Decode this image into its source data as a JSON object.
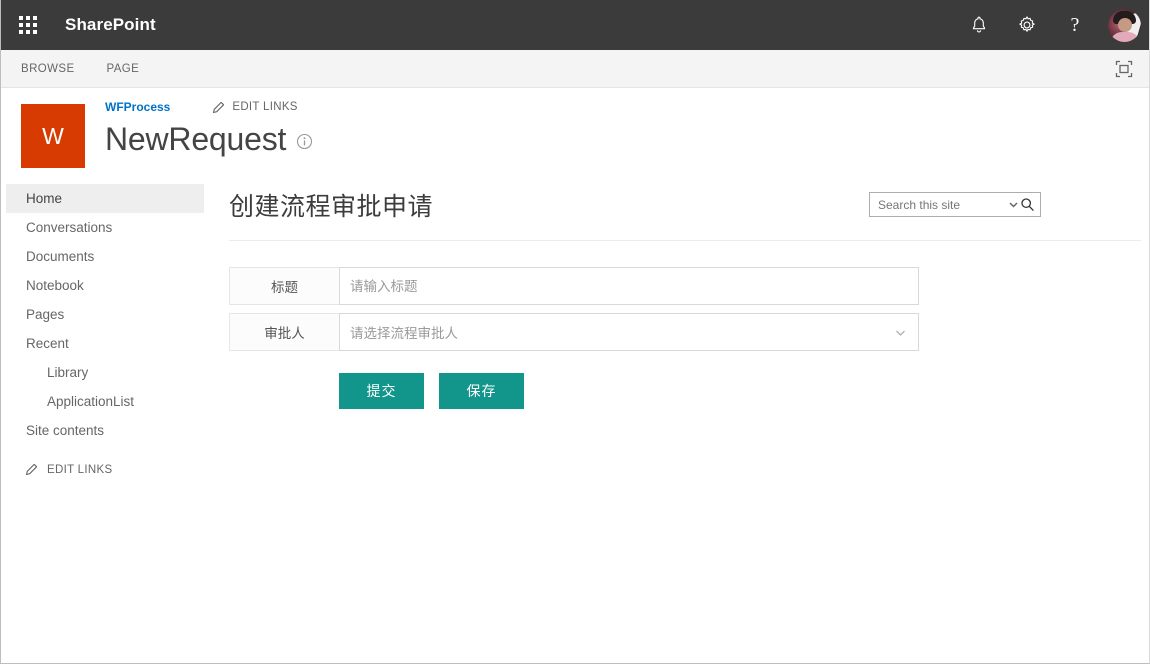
{
  "suite": {
    "app_launcher": "app-launcher",
    "title": "SharePoint",
    "icons": {
      "notifications": "bell-icon",
      "settings": "gear-icon",
      "help": "?",
      "avatar": "user-avatar"
    }
  },
  "ribbon": {
    "tabs": [
      {
        "label": "BROWSE"
      },
      {
        "label": "PAGE"
      }
    ],
    "focus_on_content": "focus-on-content-icon"
  },
  "site_header": {
    "logo_letter": "W",
    "site_link": "WFProcess",
    "edit_links_label": "EDIT LINKS",
    "page_title": "NewRequest",
    "info_icon": "info-icon"
  },
  "search": {
    "placeholder": "Search this site",
    "value": "",
    "caret_icon": "chevron-down-icon",
    "search_icon": "search-icon"
  },
  "sidebar": {
    "items": [
      {
        "label": "Home",
        "selected": true,
        "child": false
      },
      {
        "label": "Conversations",
        "selected": false,
        "child": false
      },
      {
        "label": "Documents",
        "selected": false,
        "child": false
      },
      {
        "label": "Notebook",
        "selected": false,
        "child": false
      },
      {
        "label": "Pages",
        "selected": false,
        "child": false
      },
      {
        "label": "Recent",
        "selected": false,
        "child": false
      },
      {
        "label": "Library",
        "selected": false,
        "child": true
      },
      {
        "label": "ApplicationList",
        "selected": false,
        "child": true
      },
      {
        "label": "Site contents",
        "selected": false,
        "child": false
      }
    ],
    "edit_links_label": "EDIT LINKS"
  },
  "main": {
    "heading": "创建流程审批申请",
    "fields": [
      {
        "label": "标题",
        "placeholder": "请输入标题",
        "value": "",
        "type": "text"
      },
      {
        "label": "审批人",
        "placeholder": "请选择流程审批人",
        "value": "",
        "type": "select"
      }
    ],
    "buttons": [
      {
        "label": "提交",
        "name": "submit-button"
      },
      {
        "label": "保存",
        "name": "save-button"
      }
    ]
  },
  "colors": {
    "suite_bar": "#3b3b3b",
    "logo": "#d83b01",
    "accent_button": "#12958a",
    "link": "#0072c6"
  }
}
